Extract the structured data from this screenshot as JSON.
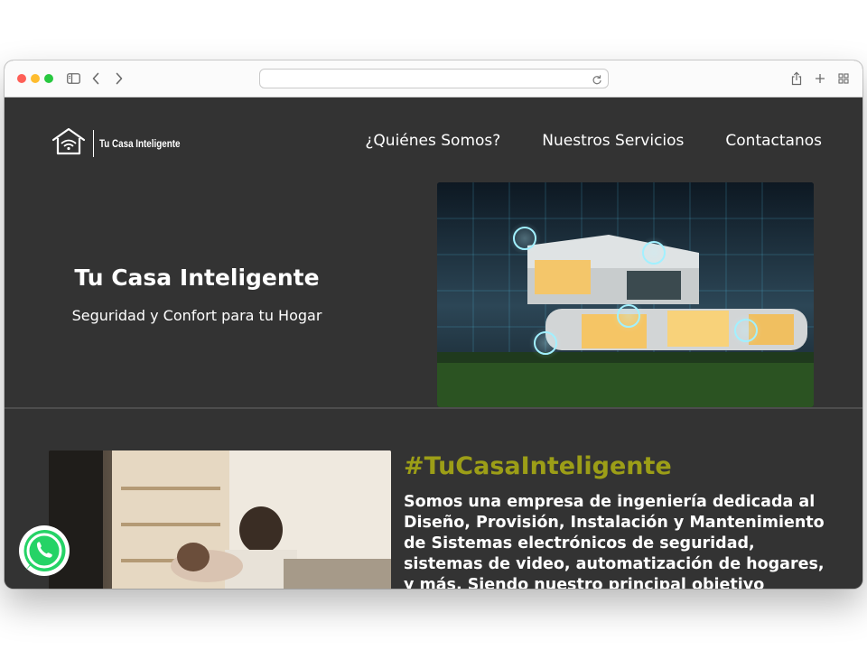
{
  "browser": {
    "url": "",
    "traffic_lights": [
      "#fe5f57",
      "#febc2e",
      "#28c840"
    ]
  },
  "site": {
    "logo_text": "Tu Casa Inteligente",
    "nav": [
      "¿Quiénes Somos?",
      "Nuestros Servicios",
      "Contactanos"
    ],
    "hero": {
      "title": "Tu Casa Inteligente",
      "subtitle": "Seguridad y Confort para tu Hogar"
    },
    "about": {
      "hashtag": "#TuCasaInteligente",
      "text": "Somos una empresa de ingeniería dedicada al Diseño, Provisión, Instalación y Mantenimiento de Sistemas electrónicos de seguridad, sistemas de video, automatización de hogares, y más. Siendo nuestro principal objetivo asesorar y"
    },
    "colors": {
      "background": "#333333",
      "accent": "#9c9e17",
      "whatsapp": "#25d366"
    }
  },
  "icons": [
    "sidebar-icon",
    "back-icon",
    "forward-icon",
    "reload-icon",
    "share-icon",
    "new-tab-icon",
    "tab-overview-icon",
    "house-wifi-icon",
    "whatsapp-icon"
  ]
}
